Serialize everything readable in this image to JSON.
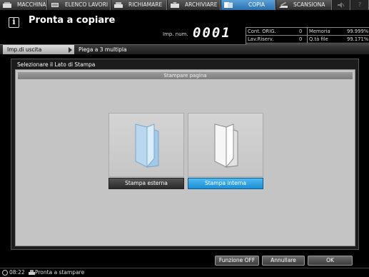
{
  "tabs": [
    {
      "label": "MACCHINA",
      "icon": "machine-icon"
    },
    {
      "label": "ELENCO LAVORI",
      "icon": "job-list-icon"
    },
    {
      "label": "RICHIAMARE",
      "icon": "recall-icon"
    },
    {
      "label": "ARCHIVIARE",
      "icon": "store-icon"
    },
    {
      "label": "COPIA",
      "icon": "copy-icon"
    },
    {
      "label": "SCANSIONA",
      "icon": "scan-icon"
    }
  ],
  "header": {
    "status": "Pronta a copiare",
    "counter_label": "Imp. num.",
    "counter_value": "0001"
  },
  "info": {
    "cont_orig_label": "Cont. ORIG.",
    "cont_orig_value": "0",
    "memoria_label": "Memoria",
    "memoria_value": "99.999%",
    "lav_riserv_label": "Lav.Riserv.",
    "lav_riserv_value": "0",
    "qta_file_label": "Q.tà file",
    "qta_file_value": "99.171%"
  },
  "breadcrumb": {
    "item1": "Imp.di uscita",
    "item2": "Piega a 3 multipla"
  },
  "main": {
    "title": "Selezionare il Lato di Stampa",
    "section_header": "Stampare pagina",
    "option_outside_label": "Stampa esterna",
    "option_inside_label": "Stampa interna",
    "selected": "Stampa interna"
  },
  "buttons": {
    "funzione_off": "Funzione OFF",
    "annullare": "Annullare",
    "ok": "OK"
  },
  "statusbar": {
    "time": "08:22",
    "status": "Pronta a stampare"
  },
  "colors": {
    "active_tab": "#3a86c8",
    "selected_option": "#2fa3e6"
  }
}
